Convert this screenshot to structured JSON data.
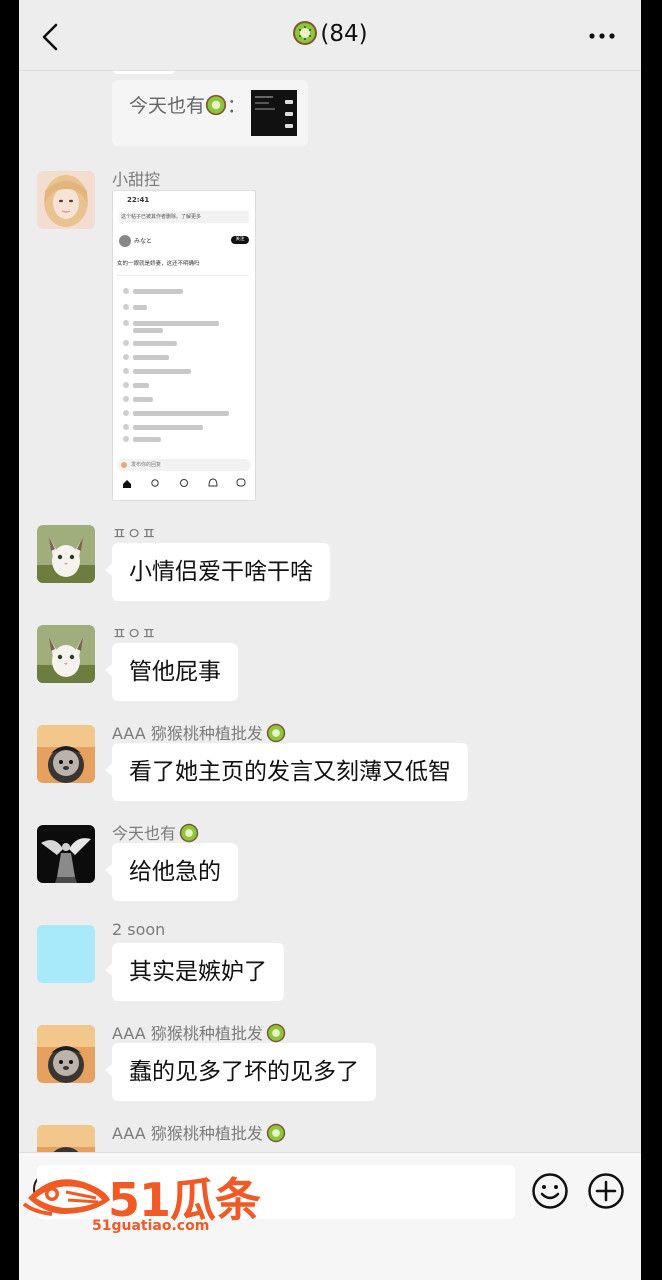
{
  "header": {
    "group_count": "(84)",
    "back_icon": "chevron-left-icon",
    "more_icon": "more-icon"
  },
  "quote": {
    "text": "今天也有"
  },
  "image_message": {
    "sender": "小甜控",
    "screenshot": {
      "time": "22:41",
      "notice": "这个帖子已被其作者删除。了解更多",
      "user": "みなと",
      "follow": "关注",
      "post": "女的一眼就是娇妻，这还不明确吗",
      "reply_placeholder": "发布你的回复"
    }
  },
  "messages": [
    {
      "sender": "ㅍㅇㅍ",
      "sender_kiwi": false,
      "text": "小情侣爱干啥干啥",
      "avatar": "cat"
    },
    {
      "sender": "ㅍㅇㅍ",
      "sender_kiwi": false,
      "text": "管他屁事",
      "avatar": "cat"
    },
    {
      "sender": "AAA 猕猴桃种植批发",
      "sender_kiwi": true,
      "text": "看了她主页的发言又刻薄又低智",
      "avatar": "seal"
    },
    {
      "sender": "今天也有",
      "sender_kiwi": true,
      "text": "给他急的",
      "avatar": "figure"
    },
    {
      "sender": "2 soon",
      "sender_kiwi": false,
      "text": "其实是嫉妒了",
      "avatar": "plain"
    },
    {
      "sender": "AAA 猕猴桃种植批发",
      "sender_kiwi": true,
      "text": "蠢的见多了坏的见多了",
      "avatar": "seal"
    },
    {
      "sender": "AAA 猕猴桃种植批发",
      "sender_kiwi": true,
      "text": "",
      "avatar": "seal"
    }
  ],
  "input_bar": {
    "voice_icon": "voice-icon",
    "emoji_icon": "emoji-icon",
    "plus_icon": "plus-icon"
  },
  "watermark": {
    "brand": "51瓜条",
    "url": "51guatiao.com"
  },
  "colors": {
    "background": "#ededed",
    "bubble": "#ffffff",
    "watermark": "#f15a24"
  }
}
